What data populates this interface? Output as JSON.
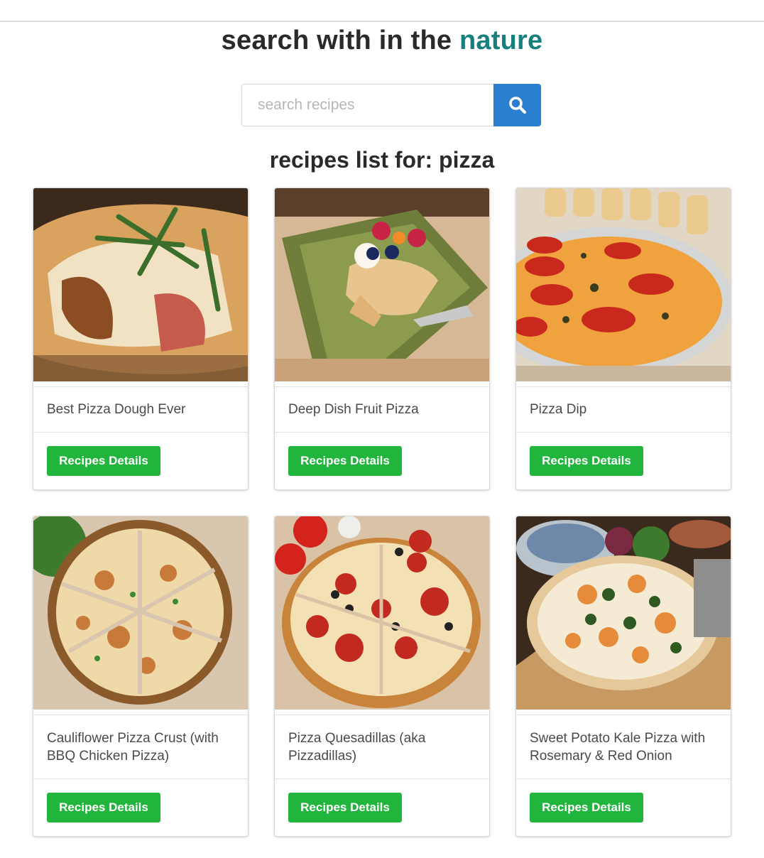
{
  "header": {
    "title_prefix": "search with in the ",
    "title_accent": "nature",
    "accent_color": "#17807e"
  },
  "search": {
    "placeholder": "search recipes",
    "value": "",
    "button_icon": "search-icon",
    "button_color": "#2a7fd0"
  },
  "results": {
    "heading": "recipes list for: pizza",
    "button_color": "#22b53e",
    "recipes": [
      {
        "title": "Best Pizza Dough Ever",
        "button_label": "Recipes Details",
        "image": "pizza-dough-photo"
      },
      {
        "title": "Deep Dish Fruit Pizza",
        "button_label": "Recipes Details",
        "image": "fruit-pizza-photo"
      },
      {
        "title": "Pizza Dip",
        "button_label": "Recipes Details",
        "image": "pizza-dip-photo"
      },
      {
        "title": "Cauliflower Pizza Crust (with BBQ Chicken Pizza)",
        "button_label": "Recipes Details",
        "image": "cauliflower-pizza-photo"
      },
      {
        "title": "Pizza Quesadillas (aka Pizzadillas)",
        "button_label": "Recipes Details",
        "image": "quesadilla-pizza-photo"
      },
      {
        "title": "Sweet Potato Kale Pizza with Rosemary & Red Onion",
        "button_label": "Recipes Details",
        "image": "sweet-potato-pizza-photo"
      }
    ]
  }
}
